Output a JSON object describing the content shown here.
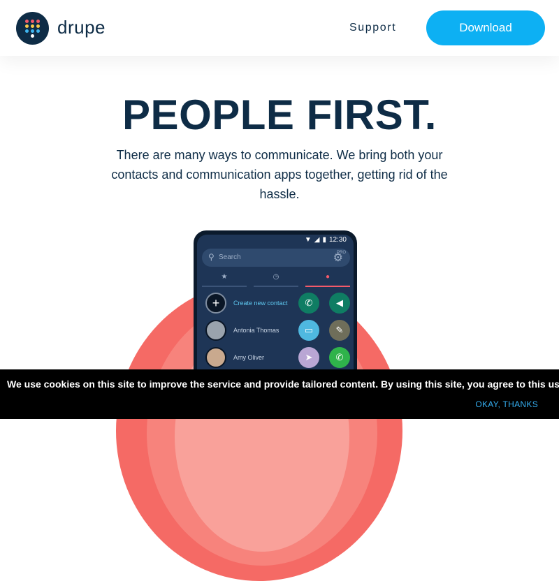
{
  "header": {
    "brand": "drupe",
    "nav_support": "Support",
    "download_label": "Download"
  },
  "hero": {
    "title": "PEOPLE FIRST.",
    "subtitle": "There are many ways to communicate. We bring both your contacts and communication apps together, getting rid of the hassle."
  },
  "phone": {
    "time": "12:30",
    "search_placeholder": "Search",
    "pro_badge": "PRO",
    "contacts": [
      {
        "name": "Create new contact"
      },
      {
        "name": "Antonia Thomas"
      },
      {
        "name": "Amy Oliver"
      }
    ]
  },
  "cookie": {
    "text": "We use cookies on this site to improve the service and provide tailored content. By using this site, you agree to this use.",
    "button": "OKAY, THANKS"
  },
  "colors": {
    "navy": "#0e2c46",
    "accent_blue": "#0db0f3",
    "coral": "#f56a65"
  }
}
